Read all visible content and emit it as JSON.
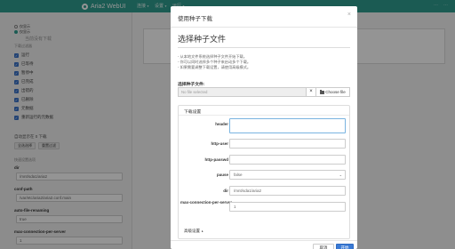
{
  "topnav": {
    "brand": "Aria2 WebUI",
    "menus": [
      "连接",
      "设置",
      "运行"
    ],
    "right_links": [
      "⋯",
      "⋯"
    ]
  },
  "sidebar": {
    "radio_options": [
      "仅显示",
      "仅显示"
    ],
    "filter_heading": "下载过滤器",
    "filters": [
      "运行",
      "已等待",
      "暂停中",
      "已完成",
      "出错的",
      "已删除",
      "元数据",
      "重新运行的元数据"
    ],
    "auto_label": "自动显示在 0 下载",
    "buttons": [
      "全选选择",
      "重置过滤"
    ],
    "section_heading": "快速设置选项",
    "options": [
      {
        "label": "dir",
        "value": "/mnt/sda1/aria2"
      },
      {
        "label": "conf-path",
        "value": "/var/etc/aria2/aria2.conf.main"
      },
      {
        "label": "auto-file-renaming",
        "value": "true"
      },
      {
        "label": "max-connection-per-server",
        "value": "1"
      }
    ]
  },
  "content": {
    "hint": "当前没有下载"
  },
  "modal": {
    "title": "使用种子下载",
    "close": "×",
    "section_title": "选择种子文件",
    "help": [
      "- 从本地文件系统选择种子文件开始下载。",
      "- 你可以同时选择多个种子来启动多个下载。",
      "- 如果需要调整下载设置，请使用高级模式。"
    ],
    "file_label": "选择种子文件:",
    "file_placeholder": "No file selected",
    "clear": "×",
    "choose_button": "Choose file",
    "settings_heading": "下载设置",
    "fields": [
      {
        "label": "header",
        "value": ""
      },
      {
        "label": "http-user",
        "value": ""
      },
      {
        "label": "http-passwd",
        "value": ""
      },
      {
        "label": "pause",
        "value": "false"
      },
      {
        "label": "dir",
        "value": "/mnt/sda1/aria2"
      },
      {
        "label": "max-connection-per-server",
        "value": "1"
      }
    ],
    "advanced": "高级设置",
    "cancel": "取消",
    "start": "开始"
  }
}
